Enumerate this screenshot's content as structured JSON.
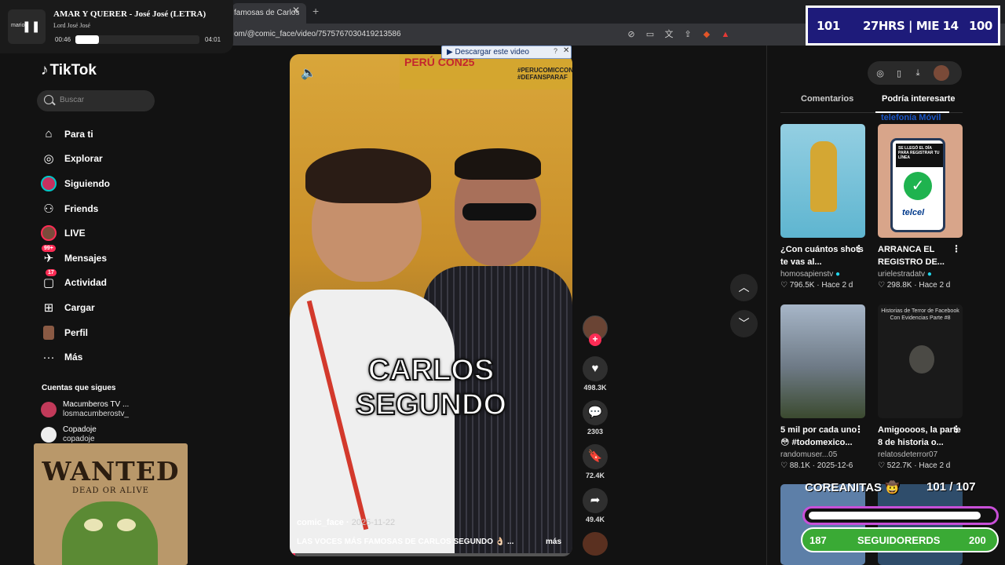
{
  "browser": {
    "tab_title": "famosas de Carlos",
    "url": "om/@comic_face/video/7575767030419213586"
  },
  "player": {
    "title": "AMAR Y QUERER - José José (LETRA)",
    "artist": "Lord José José",
    "logo": "mario",
    "elapsed": "00:46",
    "duration": "04:01",
    "progress": 0.19
  },
  "sidebar": {
    "logo": "TikTok",
    "search_placeholder": "Buscar",
    "items": [
      {
        "label": "Para ti",
        "icon": "home-icon"
      },
      {
        "label": "Explorar",
        "icon": "compass-icon"
      },
      {
        "label": "Siguiendo",
        "icon": "following-avatar-icon"
      },
      {
        "label": "Friends",
        "icon": "friends-icon"
      },
      {
        "label": "LIVE",
        "icon": "live-avatar-icon"
      },
      {
        "label": "Mensajes",
        "icon": "messages-icon",
        "badge": "99+"
      },
      {
        "label": "Actividad",
        "icon": "activity-icon",
        "badge": "17"
      },
      {
        "label": "Cargar",
        "icon": "upload-icon"
      },
      {
        "label": "Perfil",
        "icon": "profile-icon"
      },
      {
        "label": "Más",
        "icon": "more-icon"
      }
    ],
    "following_title": "Cuentas que sigues",
    "following": [
      {
        "name": "Macumberos TV ...",
        "handle": "losmacumberostv_"
      },
      {
        "name": "Copadoje",
        "handle": "copadoje"
      }
    ]
  },
  "wanted": {
    "title": "WANTED",
    "subtitle": "DEAD OR ALIVE"
  },
  "video": {
    "download_bar": "Descargar este video",
    "banner_text": "PERÚ  CON25",
    "banner_hashtag": "#PERUCOMICCON #DEFANSPARAF",
    "caption_line1": "CARLOS",
    "caption_line2": "SEGUNDO",
    "author": "comic_face",
    "date": "2025-11-22",
    "description": "LAS VOCES MÁS FAMOSAS DE CARLOS SEGUNDO 👌🏻 ...",
    "more": "más",
    "likes": "498.3K",
    "comments": "2303",
    "saves": "72.4K",
    "shares": "49.4K"
  },
  "right_panel": {
    "tab_comments": "Comentarios",
    "tab_interesting": "Podría interesarte",
    "active_tab": "Podría interesarte",
    "cards": [
      {
        "title": "¿Con cuántos shots te vas al...",
        "author": "homosapienstv",
        "verified": true,
        "likes": "796.5K",
        "date": "Hace 2 d"
      },
      {
        "title": "ARRANCA EL REGISTRO DE...",
        "author": "urielestradatv",
        "verified": true,
        "likes": "298.8K",
        "date": "Hace 2 d"
      },
      {
        "title": "5 mil por cada uno 😳 #todomexico...",
        "author": "randomuser...05",
        "verified": false,
        "likes": "88.1K",
        "date": "2025-12-6"
      },
      {
        "title": "Amigoooos, la parte 8 de historia o...",
        "author": "relatosdeterror07",
        "verified": false,
        "likes": "522.7K",
        "date": "Hace 2 d"
      }
    ],
    "card2_overlay": "telefonía Móvil",
    "card2_note": "SE LLEGÓ EL DÍA PARA REGISTRAR TU LÍNEA",
    "card2_brand": "telcel",
    "card4_overlay": "Historias de Terror de Facebook Con Evidencias Parte #8"
  },
  "stream_overlay": {
    "stat_left": "101",
    "stat_mid": "27HRS | MIE 14",
    "stat_right": "100",
    "goal_title": "COREANITAS 🤠",
    "goal_count": "101 / 107",
    "goal_progress": 0.944,
    "followers_left": "187",
    "followers_label": "SEGUIDORERDS",
    "followers_right": "200"
  },
  "colors": {
    "accent": "#fe2c55",
    "overlay_blue": "#1e1b7a",
    "followers_green": "#3aaa35"
  }
}
